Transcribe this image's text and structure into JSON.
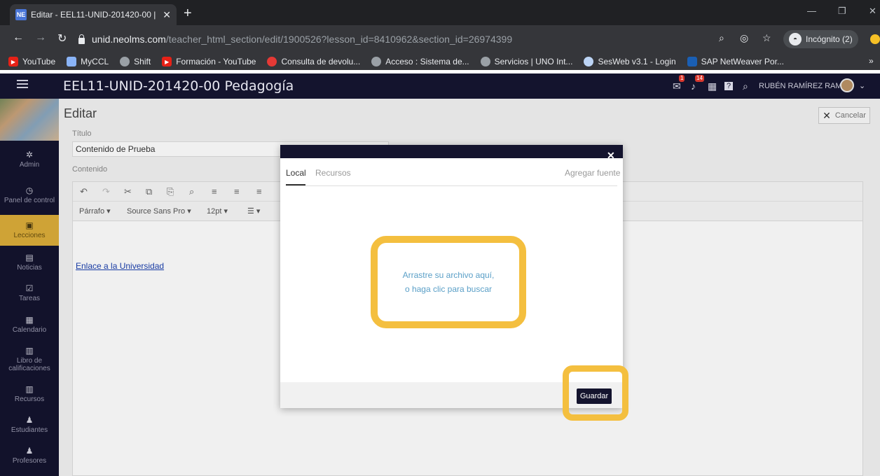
{
  "browser": {
    "tab_favicon": "NE",
    "tab_title": "Editar - EEL11-UNID-201420-00 | ",
    "tab_close": "✕",
    "new_tab": "+",
    "url_domain": "unid.neolms.com",
    "url_path": "/teacher_html_section/edit/1900526?lesson_id=8410962&section_id=26974399",
    "incognito_label": "Incógnito (2)",
    "bookmarks": [
      {
        "label": "YouTube",
        "icon": "youtube-icon",
        "color": "#e62117"
      },
      {
        "label": "MyCCL",
        "icon": "myccl-icon",
        "color": "#8ab4f8"
      },
      {
        "label": "Shift",
        "icon": "globe-icon",
        "color": "#9aa0a6"
      },
      {
        "label": "Formación - YouTube",
        "icon": "youtube-icon",
        "color": "#e62117"
      },
      {
        "label": "Consulta de devolu...",
        "icon": "circle-icon",
        "color": "#e53935"
      },
      {
        "label": "Acceso : Sistema de...",
        "icon": "globe-icon",
        "color": "#9aa0a6"
      },
      {
        "label": "Servicios | UNO Int...",
        "icon": "globe-icon",
        "color": "#9aa0a6"
      },
      {
        "label": "SesWeb v3.1 - Login",
        "icon": "circle-icon",
        "color": "#bcd4f5"
      },
      {
        "label": "SAP NetWeaver Por...",
        "icon": "sap-icon",
        "color": "#1a5fb4"
      }
    ],
    "bookmarks_more": "»"
  },
  "header": {
    "course_title": "EEL11-UNID-201420-00 Pedagogía",
    "notif_badge_1": "1",
    "notif_badge_2": "14",
    "user_name": "RUBÉN RAMÍREZ RAM..."
  },
  "sidebar": {
    "items": [
      {
        "label": "Admin",
        "icon": "gear-icon"
      },
      {
        "label": "Panel de control",
        "icon": "dashboard-icon"
      },
      {
        "label": "Lecciones",
        "icon": "lessons-icon"
      },
      {
        "label": "Noticias",
        "icon": "news-icon"
      },
      {
        "label": "Tareas",
        "icon": "tasks-icon"
      },
      {
        "label": "Calendario",
        "icon": "calendar-icon"
      },
      {
        "label": "Libro de calificaciones",
        "icon": "gradebook-icon"
      },
      {
        "label": "Recursos",
        "icon": "resources-icon"
      },
      {
        "label": "Estudiantes",
        "icon": "students-icon"
      },
      {
        "label": "Profesores",
        "icon": "teachers-icon"
      }
    ],
    "active": "Lecciones"
  },
  "page": {
    "title": "Editar",
    "cancel_label": "Cancelar",
    "titulo_label": "Título",
    "titulo_value": "Contenido de Prueba",
    "contenido_label": "Contenido",
    "format_paragraph": "Párrafo",
    "format_font": "Source Sans Pro",
    "format_size": "12pt",
    "link_text": "Enlace a la Universidad"
  },
  "modal": {
    "tabs": [
      "Local",
      "Recursos"
    ],
    "add_source": "Agregar fuente",
    "close": "✕",
    "dropzone_line1": "Arrastre su archivo aquí,",
    "dropzone_line2": "o haga clic para buscar",
    "save_label": "Guardar"
  },
  "colors": {
    "accent_highlight": "#f4bf3f",
    "header_bg": "#14142e",
    "link": "#1a3fae"
  }
}
